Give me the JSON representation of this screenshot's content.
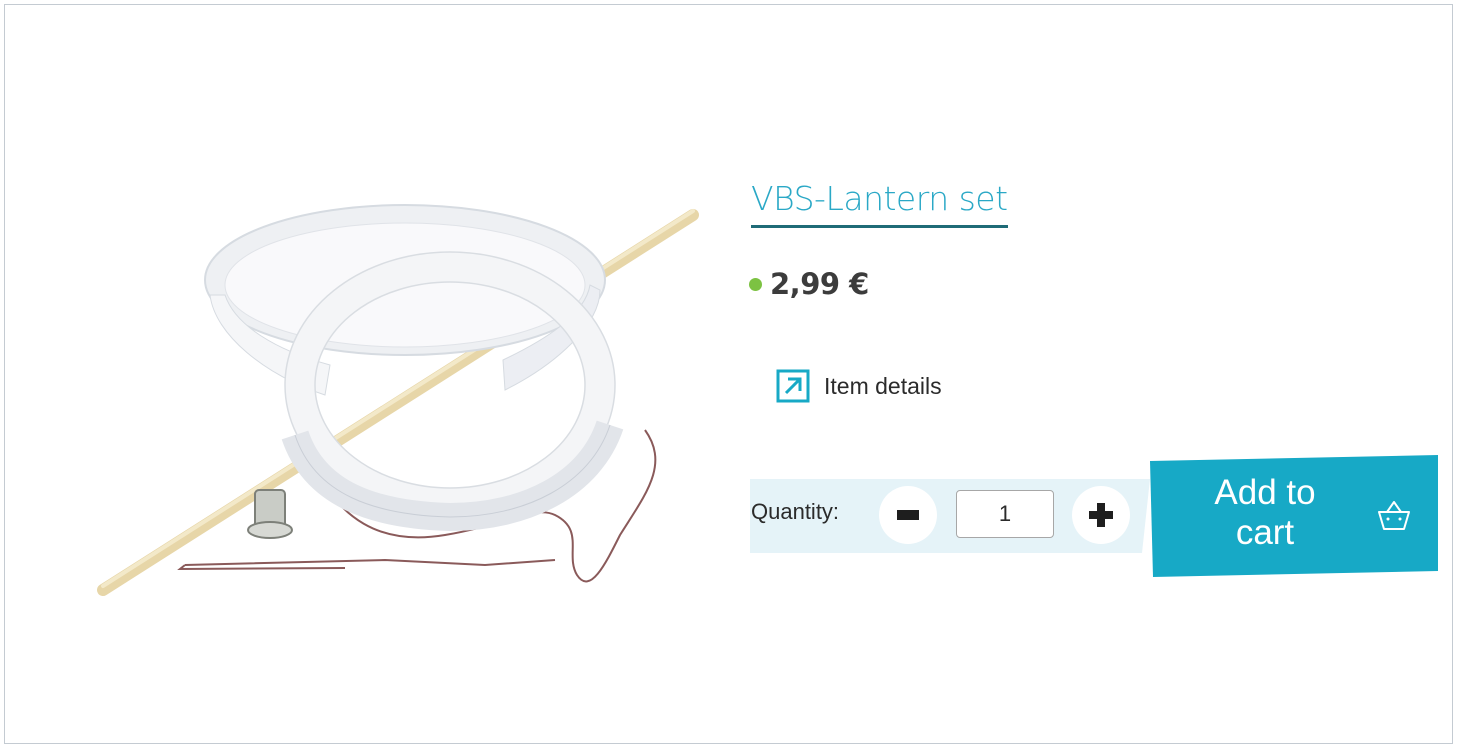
{
  "product": {
    "title": "VBS-Lantern set",
    "price": "2,99 €",
    "availability_color": "#7cc242"
  },
  "links": {
    "details_label": "Item details",
    "details_icon": "external-arrow-icon"
  },
  "quantity": {
    "label": "Quantity:",
    "value": "1",
    "minus_icon": "minus-icon",
    "plus_icon": "plus-icon"
  },
  "cart": {
    "label": "Add to cart",
    "icon": "basket-icon"
  },
  "colors": {
    "accent": "#17a9c6",
    "link": "#2aa8c6",
    "link_underline": "#1f6b77",
    "quantity_band": "#e5f3f8"
  }
}
